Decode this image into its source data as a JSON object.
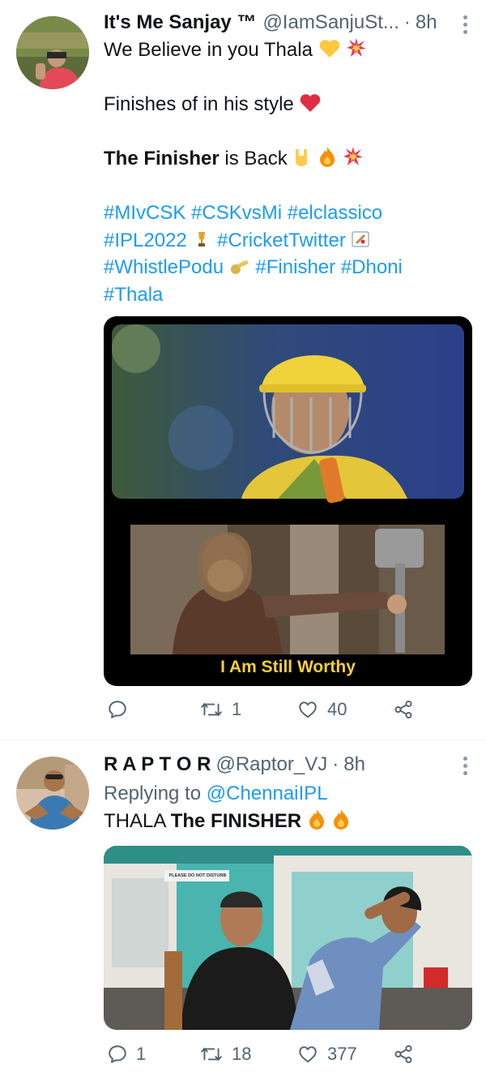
{
  "tweet1": {
    "display_name": "It's Me Sanjay ™",
    "handle": "@IamSanjuSt...",
    "dot": "·",
    "time": "8h",
    "lines": {
      "l1": "We Believe in you Thala",
      "l2": "Finishes of in his style",
      "l3_bold": "The Finisher",
      "l3_rest": " is Back"
    },
    "hashtags": {
      "h1": "#MIvCSK",
      "h2": "#CSKvsMi",
      "h3": "#elclassico",
      "h4": "#IPL2022",
      "h5": "#CricketTwitter",
      "h6": "#WhistlePodu",
      "h7": "#Finisher",
      "h8": "#Dhoni",
      "h9": "#Thala"
    },
    "media_caption": "I Am Still Worthy",
    "actions": {
      "reply": "",
      "retweet": "1",
      "like": "40"
    }
  },
  "tweet2": {
    "display_name": "R A P T O R",
    "handle": "@Raptor_VJ",
    "dot": "·",
    "time": "8h",
    "replying_prefix": "Replying to ",
    "replying_to": "@ChennaiIPL",
    "text_plain": "THALA ",
    "text_bold": "The FINISHER",
    "media_sign": "PLEASE DO NOT DISTURB",
    "actions": {
      "reply": "1",
      "retweet": "18",
      "like": "377"
    }
  },
  "icons": {
    "reply": "speech-bubble-icon",
    "retweet": "retweet-arrows-icon",
    "like": "heart-outline-icon",
    "share": "share-nodes-icon",
    "more": "vertical-dots-icon"
  },
  "colors": {
    "link": "#1d9bf0",
    "muted": "#536471",
    "caption": "#f5d03b"
  }
}
